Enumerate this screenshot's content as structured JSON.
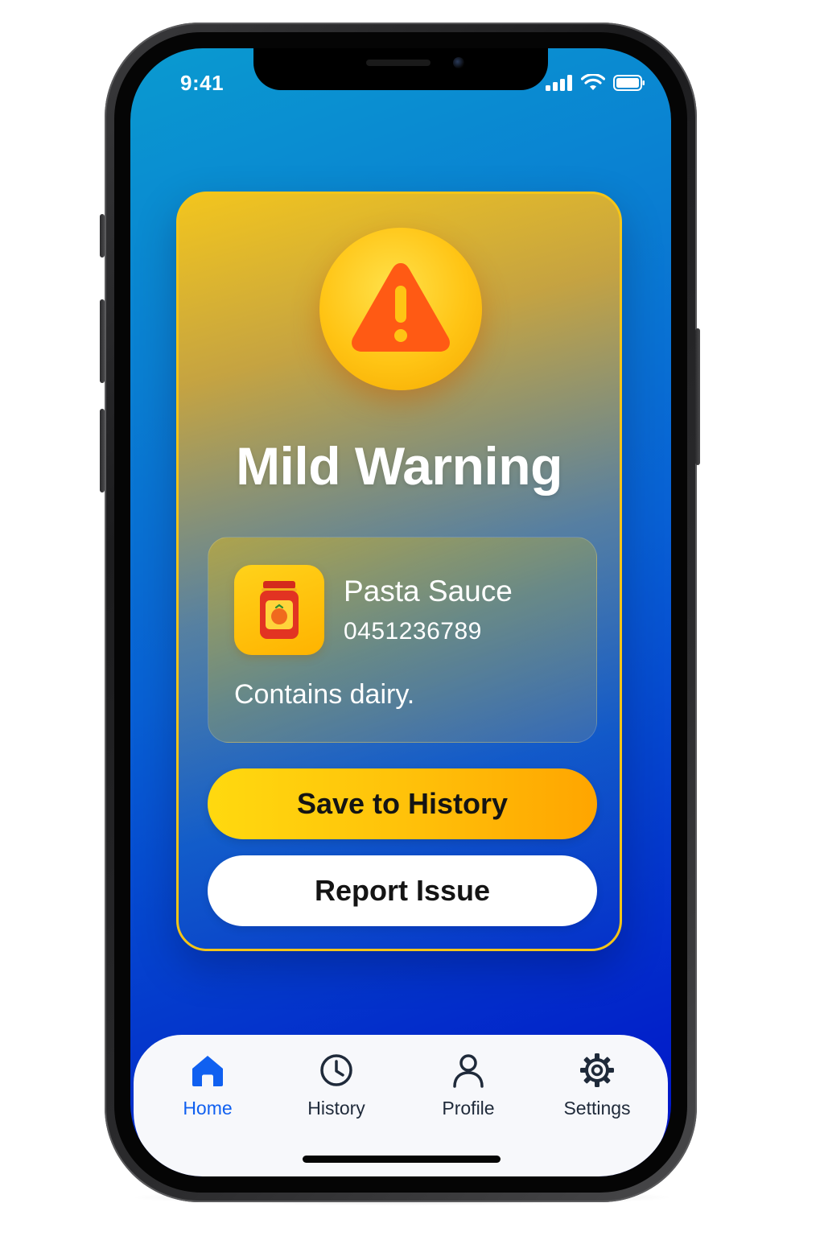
{
  "status_bar": {
    "time": "9:41",
    "icons": [
      "cellular-signal-icon",
      "wifi-icon",
      "battery-icon"
    ]
  },
  "alert": {
    "icon": "warning-triangle-icon",
    "title": "Mild Warning",
    "accent_color": "#ffc414",
    "icon_color": "#ff5a14"
  },
  "product": {
    "icon": "sauce-jar-icon",
    "name": "Pasta Sauce",
    "code": "0451236789",
    "note": "Contains dairy."
  },
  "actions": {
    "save_label": "Save to History",
    "report_label": "Report Issue"
  },
  "tabbar": {
    "active": "Home",
    "active_color": "#1060f0",
    "items": [
      {
        "label": "Home",
        "icon": "home-icon"
      },
      {
        "label": "History",
        "icon": "clock-icon"
      },
      {
        "label": "Profile",
        "icon": "person-icon"
      },
      {
        "label": "Settings",
        "icon": "gear-icon"
      }
    ]
  }
}
